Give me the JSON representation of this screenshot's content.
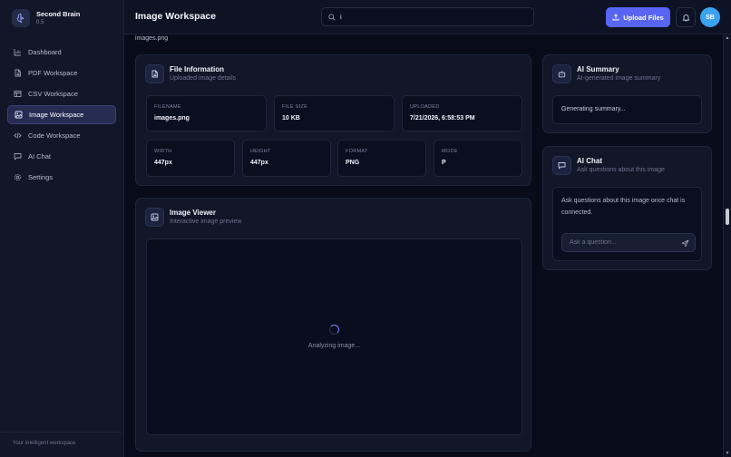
{
  "brand": {
    "name": "Second Brain",
    "version": "0.5"
  },
  "sidebar": {
    "items": [
      {
        "label": "Dashboard",
        "icon": "bar-chart-icon",
        "active": false
      },
      {
        "label": "PDF Workspace",
        "icon": "document-icon",
        "active": false
      },
      {
        "label": "CSV Workspace",
        "icon": "table-icon",
        "active": false
      },
      {
        "label": "Image Workspace",
        "icon": "image-icon",
        "active": true
      },
      {
        "label": "Code Workspace",
        "icon": "code-icon",
        "active": false
      },
      {
        "label": "AI Chat",
        "icon": "chat-icon",
        "active": false
      },
      {
        "label": "Settings",
        "icon": "gear-icon",
        "active": false
      }
    ],
    "footer": "Your intelligent workspace"
  },
  "header": {
    "title": "Image Workspace",
    "search_value": "i",
    "upload_label": "Upload Files",
    "avatar_initials": "SB"
  },
  "breadcrumb": {
    "filename": "images.png"
  },
  "file_info": {
    "title": "File Information",
    "subtitle": "Uploaded image details",
    "fields": [
      {
        "label": "FILENAME",
        "value": "images.png"
      },
      {
        "label": "FILE SIZE",
        "value": "10 KB"
      },
      {
        "label": "UPLOADED",
        "value": "7/21/2026, 6:58:53 PM"
      },
      {
        "label": "WIDTH",
        "value": "447px"
      },
      {
        "label": "HEIGHT",
        "value": "447px"
      },
      {
        "label": "FORMAT",
        "value": "PNG"
      },
      {
        "label": "MODE",
        "value": "P"
      }
    ]
  },
  "viewer": {
    "title": "Image Viewer",
    "subtitle": "Interactive image preview",
    "status": "Analyzing image..."
  },
  "summary": {
    "title": "AI Summary",
    "subtitle": "AI-generated image summary",
    "status": "Generating summary..."
  },
  "chat": {
    "title": "AI Chat",
    "subtitle": "Ask questions about this image",
    "message": "Ask questions about this image once chat is connected.",
    "placeholder": "Ask a question..."
  },
  "colors": {
    "accent": "#5865f2",
    "background": "#070b1a",
    "card": "#111628",
    "avatar": "#3aa3f0"
  }
}
